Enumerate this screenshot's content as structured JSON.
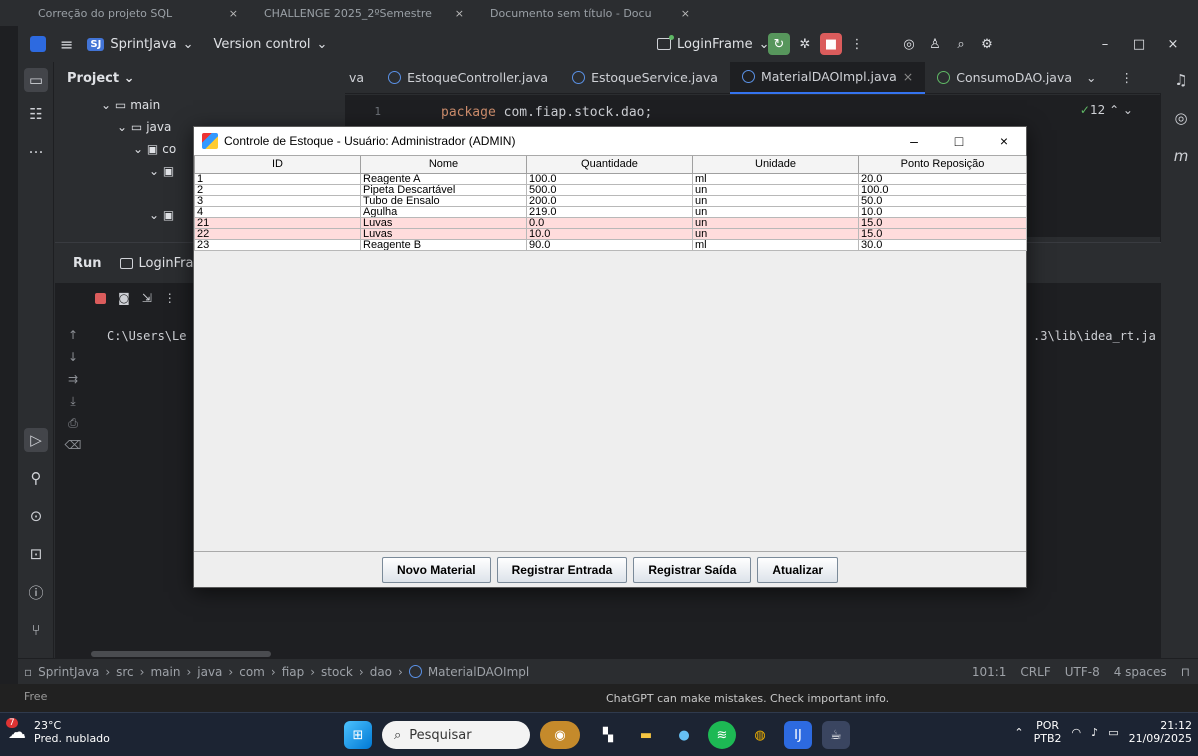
{
  "browser": {
    "tabs": [
      "Correção do projeto SQL",
      "CHALLENGE 2025_2ºSemestre",
      "Documento sem título - Docu"
    ]
  },
  "ide": {
    "project_name": "SprintJava",
    "project_badge": "SJ",
    "version_control": "Version control",
    "run_config": "LoginFrame",
    "project_panel": {
      "title": "Project",
      "tree": [
        "main",
        "java",
        "co",
        "",
        "",
        ""
      ]
    },
    "editor_tabs": [
      {
        "label": "va"
      },
      {
        "label": "EstoqueController.java"
      },
      {
        "label": "EstoqueService.java"
      },
      {
        "label": "MaterialDAOImpl.java"
      },
      {
        "label": "ConsumoDAO.java"
      }
    ],
    "editor": {
      "line_number": "1",
      "code_keyword": "package",
      "code_rest": " com.fiap.stock.dao;",
      "inspection": "12"
    },
    "run": {
      "title": "Run",
      "tab": "LoginFra",
      "console_left": "C:\\Users\\Le",
      "console_right": ".3\\lib\\idea_rt.ja"
    },
    "statusbar": {
      "breadcrumb": [
        "SprintJava",
        "src",
        "main",
        "java",
        "com",
        "fiap",
        "stock",
        "dao",
        "MaterialDAOImpl"
      ],
      "position": "101:1",
      "line_sep": "CRLF",
      "encoding": "UTF-8",
      "indent": "4 spaces"
    }
  },
  "dialog": {
    "title": "Controle de Estoque - Usuário: Administrador (ADMIN)",
    "columns": [
      "ID",
      "Nome",
      "Quantidade",
      "Unidade",
      "Ponto Reposição"
    ],
    "rows": [
      {
        "id": "1",
        "nome": "Reagente A",
        "qtd": "100.0",
        "un": "ml",
        "ponto": "20.0",
        "low": false
      },
      {
        "id": "2",
        "nome": "Pipeta Descartável",
        "qtd": "500.0",
        "un": "un",
        "ponto": "100.0",
        "low": false
      },
      {
        "id": "3",
        "nome": "Tubo de Ensalo",
        "qtd": "200.0",
        "un": "un",
        "ponto": "50.0",
        "low": false
      },
      {
        "id": "4",
        "nome": "Agulha",
        "qtd": "219.0",
        "un": "un",
        "ponto": "10.0",
        "low": false
      },
      {
        "id": "21",
        "nome": "Luvas",
        "qtd": "0.0",
        "un": "un",
        "ponto": "15.0",
        "low": true
      },
      {
        "id": "22",
        "nome": "Luvas",
        "qtd": "10.0",
        "un": "un",
        "ponto": "15.0",
        "low": true
      },
      {
        "id": "23",
        "nome": "Reagente B",
        "qtd": "90.0",
        "un": "ml",
        "ponto": "30.0",
        "low": false
      }
    ],
    "buttons": {
      "novo": "Novo Material",
      "entrada": "Registrar Entrada",
      "saida": "Registrar Saída",
      "atualizar": "Atualizar"
    },
    "low_row_color": "#ffdcdc"
  },
  "chatgpt": {
    "free": "Free",
    "disclaimer": "ChatGPT can make mistakes. Check important info."
  },
  "taskbar": {
    "weather_temp": "23°C",
    "weather_desc": "Pred. nublado",
    "weather_badge": "7",
    "search_placeholder": "Pesquisar",
    "lang": "POR",
    "layout": "PTB2",
    "time": "21:12",
    "date": "21/09/2025"
  }
}
